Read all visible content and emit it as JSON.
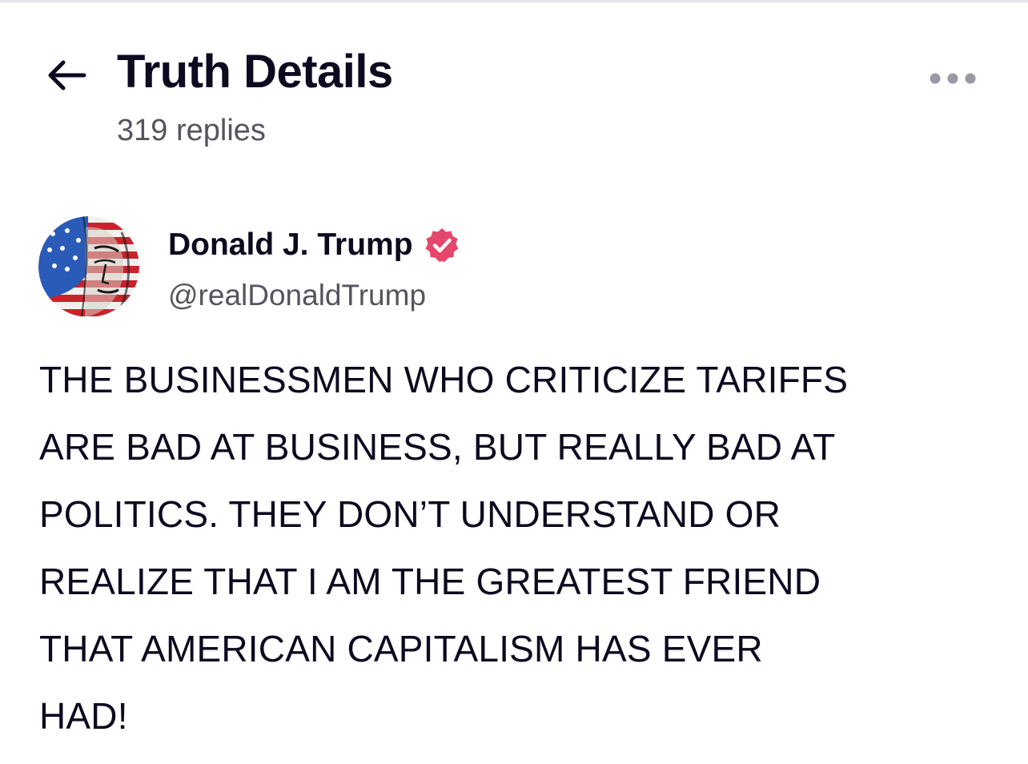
{
  "header": {
    "back_icon": "arrow-left-icon",
    "title": "Truth Details",
    "reply_count": "319 replies",
    "more_icon": "ellipsis-horizontal-icon"
  },
  "post": {
    "author": {
      "avatar_icon": "avatar-american-flag-portrait",
      "display_name": "Donald J. Trump",
      "verified_icon": "verified-check-badge-icon",
      "verified_color": "#e4476b",
      "username": "@realDonaldTrump"
    },
    "body_lines": [
      "THE BUSINESSMEN WHO CRITICIZE TARIFFS",
      "ARE BAD AT BUSINESS, BUT REALLY BAD AT",
      "POLITICS. THEY DON’T UNDERSTAND OR",
      "REALIZE THAT I AM THE GREATEST FRIEND",
      "THAT AMERICAN CAPITALISM HAS EVER",
      "HAD!"
    ]
  },
  "colors": {
    "text_primary": "#0c0a1f",
    "text_secondary": "#55545f",
    "background": "#ffffff",
    "divider": "#e6e6ea",
    "icon_gray": "#9a99a3"
  }
}
